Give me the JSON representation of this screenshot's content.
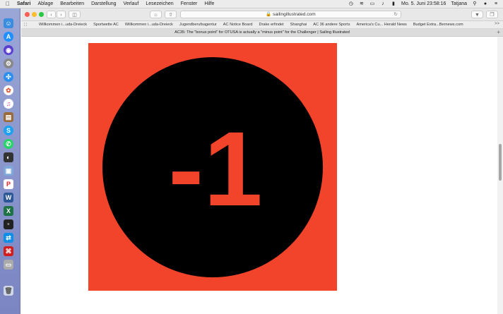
{
  "menubar": {
    "app_name": "Safari",
    "items": [
      "Ablage",
      "Bearbeiten",
      "Darstellung",
      "Verlauf",
      "Lesezeichen",
      "Fenster",
      "Hilfe"
    ],
    "clock": "Mo. 5. Juni  23:58:16",
    "user": "Tatjana"
  },
  "toolbar": {
    "address": "sailingillustrated.com"
  },
  "bookmarks": [
    "Willkommen i...uda-Dreieck",
    "Sportwette AC",
    "Willkommen i...uda-Dreieck",
    "Jugendberufsagentur",
    "AC Notice Board",
    "Drake erfindet",
    "Shanghai",
    "AC 36 andere Sports",
    "America's Cu... Herald News",
    "Budget Extra...Bernews.com"
  ],
  "tab": {
    "title": "AC35: The \"bonus point\" for OTUSA is actually a \"minus point\" for the Challenger | Sailing Illustrated"
  },
  "hero": {
    "label": "-1",
    "bg_color": "#f2432b",
    "circle_color": "#000000"
  },
  "dock_icons": [
    "finder-icon",
    "app-store-icon",
    "siri-icon",
    "system-preferences-icon",
    "safari-icon",
    "photos-icon",
    "itunes-icon",
    "book-icon",
    "skype-icon",
    "whatsapp-icon",
    "photo-app-icon",
    "preview-icon",
    "pdf-app-icon",
    "word-icon",
    "excel-icon",
    "news-app-icon",
    "teamviewer-icon",
    "acrobat-icon",
    "scanner-icon",
    "trash-icon"
  ]
}
